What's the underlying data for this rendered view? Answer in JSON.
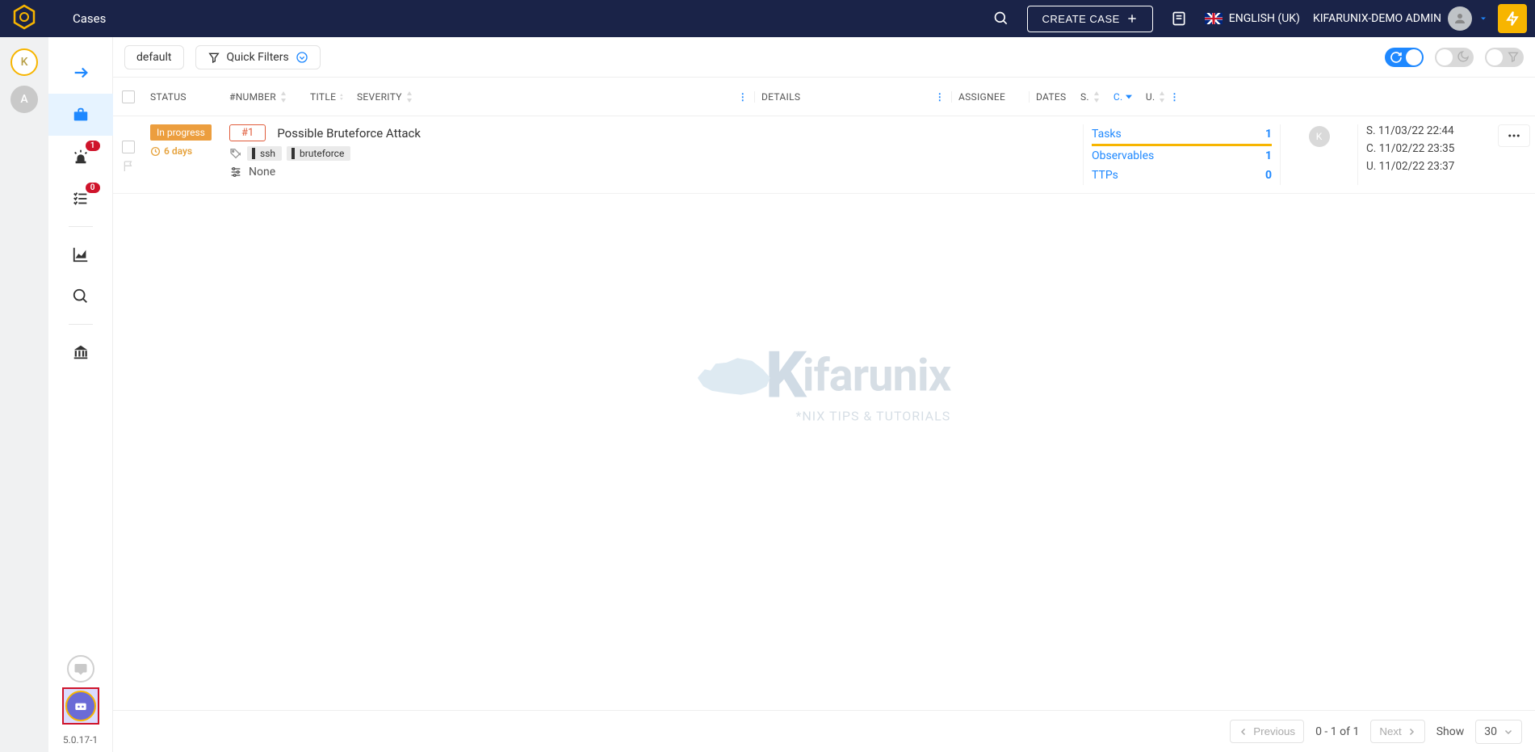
{
  "topbar": {
    "title": "Cases",
    "create_label": "CREATE CASE",
    "language": "ENGLISH (UK)",
    "user": "KIFARUNIX-DEMO ADMIN"
  },
  "leftrail": {
    "org1": "K",
    "org2": "A"
  },
  "sidenav": {
    "alerts_badge": "1",
    "tasks_badge": "0",
    "version": "5.0.17-1"
  },
  "toolbar": {
    "default_label": "default",
    "quick_filters_label": "Quick Filters"
  },
  "columns": {
    "status": "STATUS",
    "number": "#NUMBER",
    "title": "TITLE",
    "severity": "SEVERITY",
    "details": "DETAILS",
    "assignee": "ASSIGNEE",
    "dates": "DATES",
    "s": "S.",
    "c": "C.",
    "u": "U."
  },
  "row": {
    "status": "In progress",
    "age": "6 days",
    "number": "#1",
    "title": "Possible Bruteforce Attack",
    "tags": [
      "ssh",
      "bruteforce"
    ],
    "custom_fields": "None",
    "details": {
      "tasks_label": "Tasks",
      "tasks_count": "1",
      "obs_label": "Observables",
      "obs_count": "1",
      "ttps_label": "TTPs",
      "ttps_count": "0"
    },
    "assignee_initial": "K",
    "dates": {
      "s": "S. 11/03/22 22:44",
      "c": "C. 11/02/22 23:35",
      "u": "U. 11/02/22 23:37"
    }
  },
  "watermark": {
    "brand": "ifarunix",
    "tagline": "*NIX TIPS & TUTORIALS"
  },
  "footer": {
    "prev": "Previous",
    "range": "0 - 1 of 1",
    "next": "Next",
    "show": "Show",
    "per_page": "30"
  }
}
